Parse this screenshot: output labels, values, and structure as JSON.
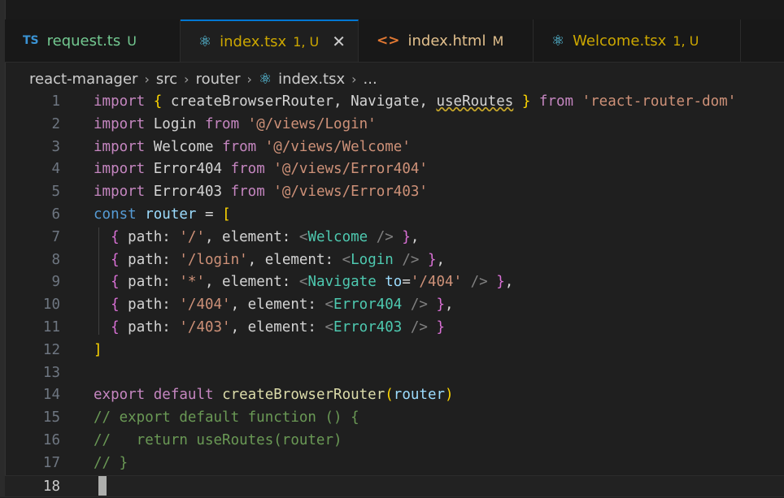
{
  "tabs": [
    {
      "icon": "TS",
      "name": "request.ts",
      "status": "U",
      "name_color": "#73c991",
      "status_color": "#73c991",
      "active": false
    },
    {
      "icon": "⚛",
      "name": "index.tsx",
      "status": "1, U",
      "name_color": "#cca700",
      "status_color": "#cca700",
      "active": true,
      "close": "✕"
    },
    {
      "icon": "<>",
      "name": "index.html",
      "status": "M",
      "name_color": "#e2c08d",
      "status_color": "#e2c08d",
      "active": false
    },
    {
      "icon": "⚛",
      "name": "Welcome.tsx",
      "status": "1, U",
      "name_color": "#cca700",
      "status_color": "#cca700",
      "active": false
    }
  ],
  "breadcrumb": {
    "parts": [
      "react-manager",
      "src",
      "router"
    ],
    "file_icon": "⚛",
    "file": "index.tsx",
    "more": "...",
    "separator": "›"
  },
  "editor": {
    "line_numbers": [
      "1",
      "2",
      "3",
      "4",
      "5",
      "6",
      "7",
      "8",
      "9",
      "10",
      "11",
      "12",
      "13",
      "14",
      "15",
      "16",
      "17",
      "18"
    ],
    "current_line": 18,
    "lines": [
      {
        "t": [
          [
            "kw",
            "import "
          ],
          [
            "br1",
            "{ "
          ],
          [
            "ids",
            "createBrowserRouter, Navigate, "
          ],
          [
            "squig",
            "useRoutes"
          ],
          [
            "br1",
            " } "
          ],
          [
            "kw",
            "from "
          ],
          [
            "str",
            "'react-router-dom'"
          ]
        ]
      },
      {
        "t": [
          [
            "kw",
            "import "
          ],
          [
            "ids",
            "Login "
          ],
          [
            "kw",
            "from "
          ],
          [
            "str",
            "'@/views/Login'"
          ]
        ]
      },
      {
        "t": [
          [
            "kw",
            "import "
          ],
          [
            "ids",
            "Welcome "
          ],
          [
            "kw",
            "from "
          ],
          [
            "str",
            "'@/views/Welcome'"
          ]
        ]
      },
      {
        "t": [
          [
            "kw",
            "import "
          ],
          [
            "ids",
            "Error404 "
          ],
          [
            "kw",
            "from "
          ],
          [
            "str",
            "'@/views/Error404'"
          ]
        ]
      },
      {
        "t": [
          [
            "kw",
            "import "
          ],
          [
            "ids",
            "Error403 "
          ],
          [
            "kw",
            "from "
          ],
          [
            "str",
            "'@/views/Error403'"
          ]
        ]
      },
      {
        "t": [
          [
            "kw2",
            "const "
          ],
          [
            "id",
            "router "
          ],
          [
            "ids",
            "= "
          ],
          [
            "br1",
            "["
          ]
        ]
      },
      {
        "t": [
          [
            "ids",
            "  "
          ],
          [
            "br2",
            "{ "
          ],
          [
            "ids",
            "path: "
          ],
          [
            "str",
            "'/'"
          ],
          [
            "ids",
            ", element: "
          ],
          [
            "punct",
            "<"
          ],
          [
            "tag",
            "Welcome"
          ],
          [
            "punct",
            " />"
          ],
          [
            "br2",
            " }"
          ],
          [
            "ids",
            ","
          ]
        ]
      },
      {
        "t": [
          [
            "ids",
            "  "
          ],
          [
            "br2",
            "{ "
          ],
          [
            "ids",
            "path: "
          ],
          [
            "str",
            "'/login'"
          ],
          [
            "ids",
            ", element: "
          ],
          [
            "punct",
            "<"
          ],
          [
            "tag",
            "Login"
          ],
          [
            "punct",
            " />"
          ],
          [
            "br2",
            " }"
          ],
          [
            "ids",
            ","
          ]
        ]
      },
      {
        "t": [
          [
            "ids",
            "  "
          ],
          [
            "br2",
            "{ "
          ],
          [
            "ids",
            "path: "
          ],
          [
            "str",
            "'*'"
          ],
          [
            "ids",
            ", element: "
          ],
          [
            "punct",
            "<"
          ],
          [
            "tag",
            "Navigate "
          ],
          [
            "id",
            "to"
          ],
          [
            "ids",
            "="
          ],
          [
            "str",
            "'/404'"
          ],
          [
            "punct",
            " />"
          ],
          [
            "br2",
            " }"
          ],
          [
            "ids",
            ","
          ]
        ]
      },
      {
        "t": [
          [
            "ids",
            "  "
          ],
          [
            "br2",
            "{ "
          ],
          [
            "ids",
            "path: "
          ],
          [
            "str",
            "'/404'"
          ],
          [
            "ids",
            ", element: "
          ],
          [
            "punct",
            "<"
          ],
          [
            "tag",
            "Error404"
          ],
          [
            "punct",
            " />"
          ],
          [
            "br2",
            " }"
          ],
          [
            "ids",
            ","
          ]
        ]
      },
      {
        "t": [
          [
            "ids",
            "  "
          ],
          [
            "br2",
            "{ "
          ],
          [
            "ids",
            "path: "
          ],
          [
            "str",
            "'/403'"
          ],
          [
            "ids",
            ", element: "
          ],
          [
            "punct",
            "<"
          ],
          [
            "tag",
            "Error403"
          ],
          [
            "punct",
            " />"
          ],
          [
            "br2",
            " }"
          ]
        ]
      },
      {
        "t": [
          [
            "br1",
            "]"
          ]
        ]
      },
      {
        "t": []
      },
      {
        "t": [
          [
            "kw",
            "export "
          ],
          [
            "kw",
            "default "
          ],
          [
            "fn",
            "createBrowserRouter"
          ],
          [
            "br1",
            "("
          ],
          [
            "id",
            "router"
          ],
          [
            "br1",
            ")"
          ]
        ]
      },
      {
        "t": [
          [
            "com",
            "// export default function () {"
          ]
        ]
      },
      {
        "t": [
          [
            "com",
            "//   return useRoutes(router)"
          ]
        ]
      },
      {
        "t": [
          [
            "com",
            "// }"
          ]
        ]
      },
      {
        "t": []
      }
    ]
  },
  "colors": {
    "accent": "#0078d4",
    "background": "#1f1f1f"
  }
}
